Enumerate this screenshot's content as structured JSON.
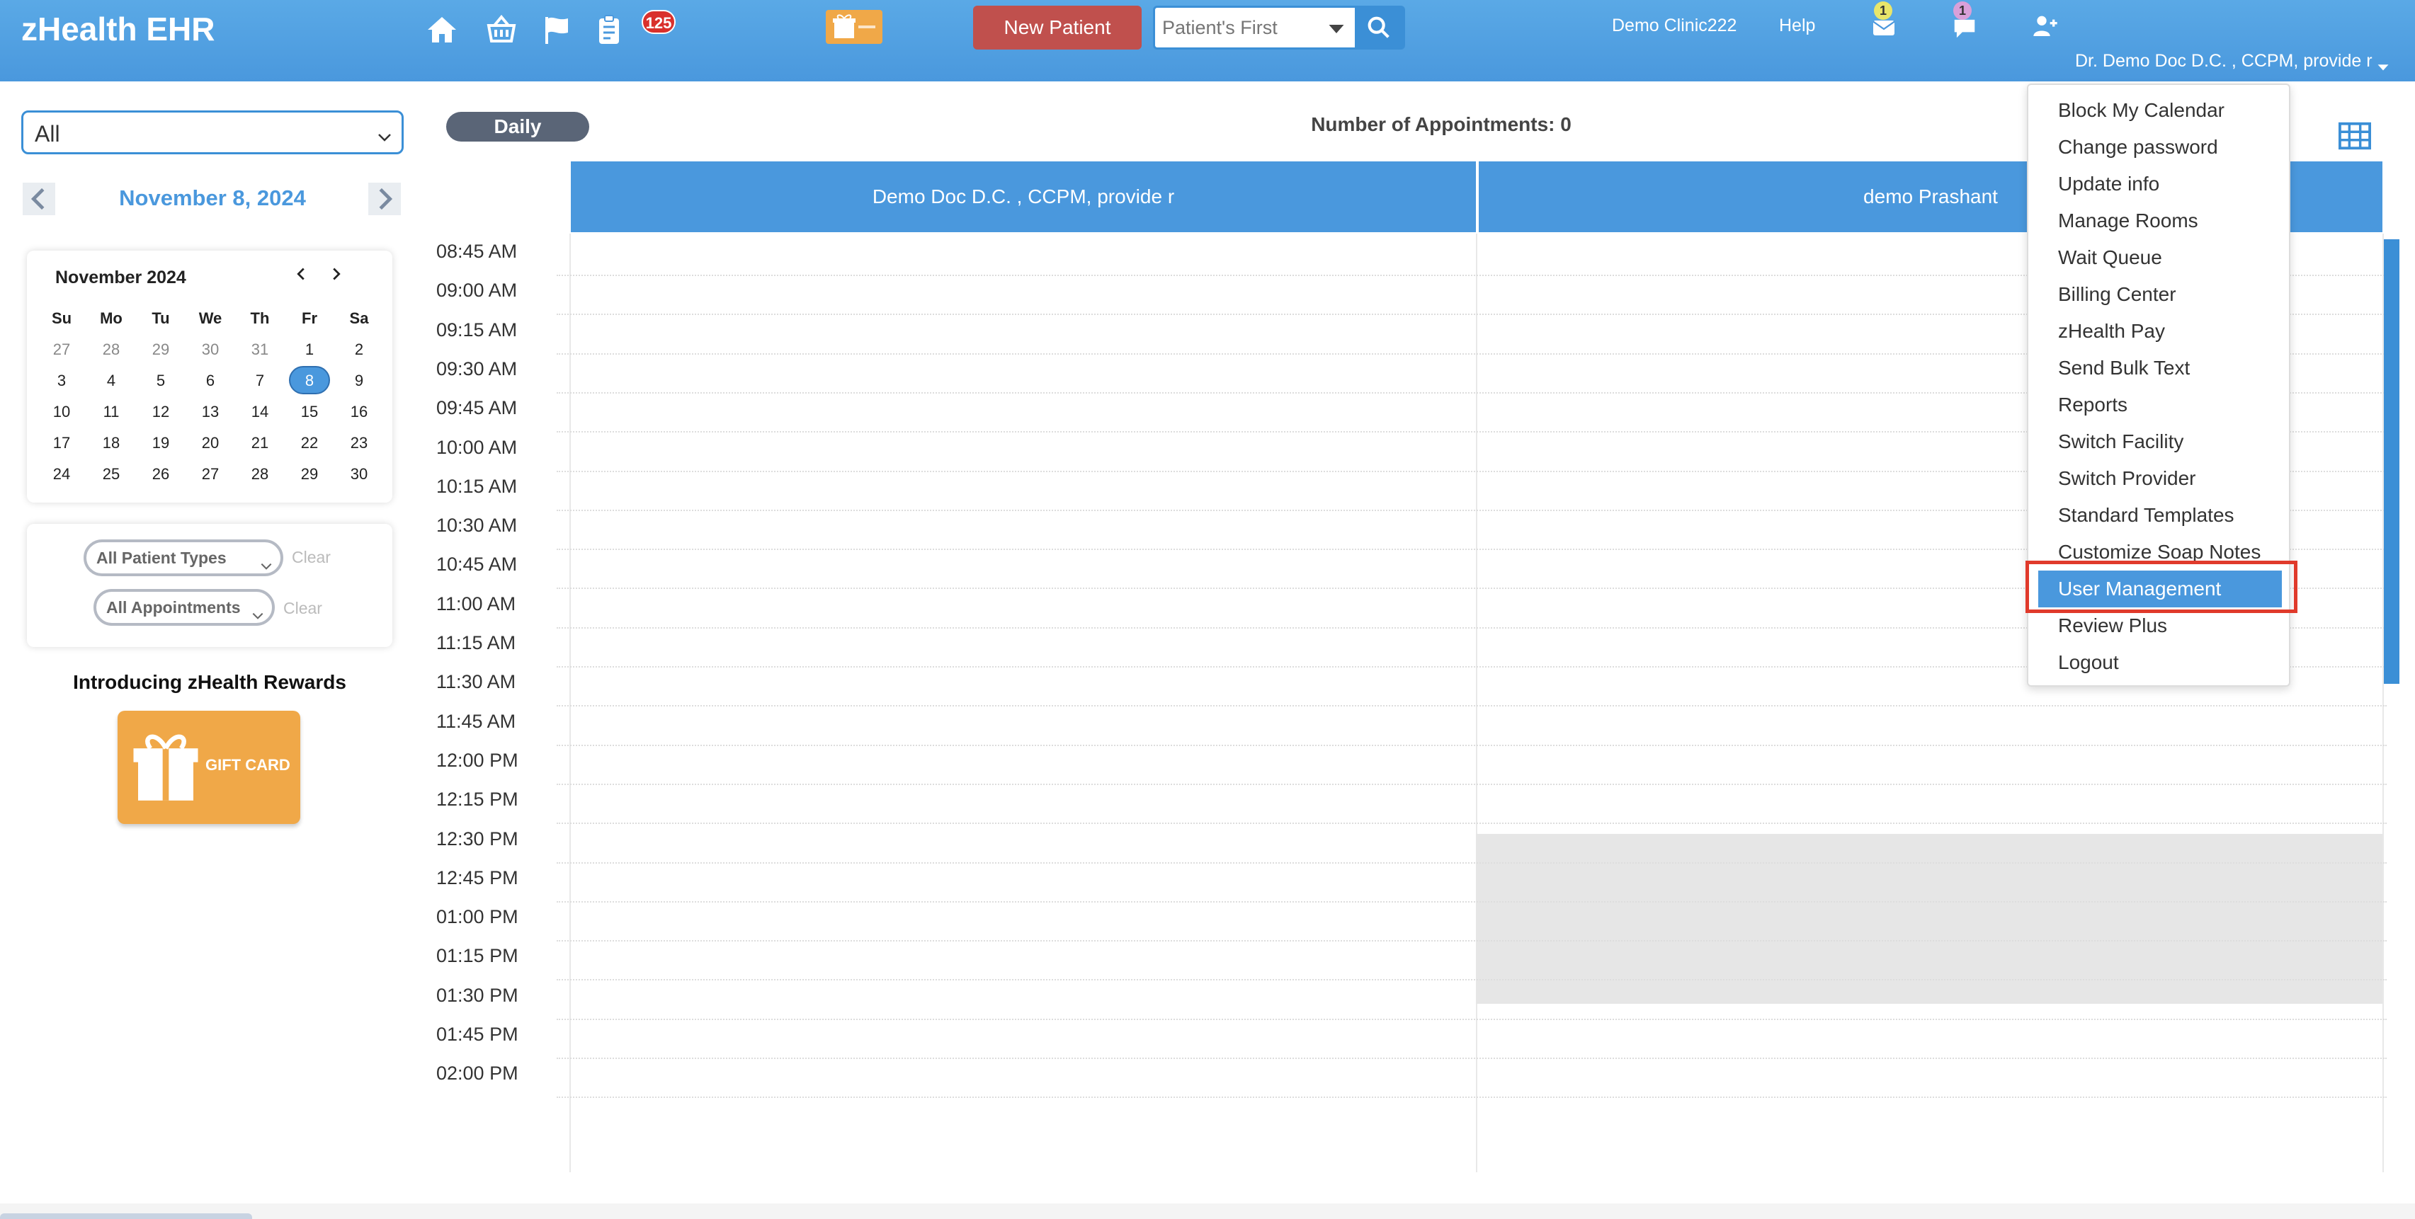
{
  "app": {
    "title": "zHealth EHR"
  },
  "header": {
    "notification_count": "125",
    "new_patient_label": "New Patient",
    "search_placeholder": "Patient's First",
    "clinic_name": "Demo Clinic222",
    "help_label": "Help",
    "mail_badge": "1",
    "chat_badge": "1",
    "user_name": "Dr. Demo Doc D.C. , CCPM, provide r"
  },
  "sidebar": {
    "provider_filter": "All",
    "current_date": "November 8, 2024",
    "calendar": {
      "month_label": "November 2024",
      "weekdays": [
        "Su",
        "Mo",
        "Tu",
        "We",
        "Th",
        "Fr",
        "Sa"
      ],
      "weeks": [
        [
          "27",
          "28",
          "29",
          "30",
          "31",
          "1",
          "2"
        ],
        [
          "3",
          "4",
          "5",
          "6",
          "7",
          "8",
          "9"
        ],
        [
          "10",
          "11",
          "12",
          "13",
          "14",
          "15",
          "16"
        ],
        [
          "17",
          "18",
          "19",
          "20",
          "21",
          "22",
          "23"
        ],
        [
          "24",
          "25",
          "26",
          "27",
          "28",
          "29",
          "30"
        ]
      ],
      "selected_day": "8"
    },
    "filters": {
      "patient_types": "All Patient Types",
      "appointments": "All Appointments",
      "clear_label": "Clear"
    },
    "rewards_title": "Introducing zHealth Rewards",
    "gift_card_label": "GIFT CARD"
  },
  "main": {
    "view_label": "Daily",
    "appointment_count": "Number of Appointments: 0",
    "columns": [
      "Demo Doc D.C. , CCPM, provide r",
      "demo Prashant"
    ],
    "time_slots": [
      "08:45 AM",
      "09:00 AM",
      "09:15 AM",
      "09:30 AM",
      "09:45 AM",
      "10:00 AM",
      "10:15 AM",
      "10:30 AM",
      "10:45 AM",
      "11:00 AM",
      "11:15 AM",
      "11:30 AM",
      "11:45 AM",
      "12:00 PM",
      "12:15 PM",
      "12:30 PM",
      "12:45 PM",
      "01:00 PM",
      "01:15 PM",
      "01:30 PM",
      "01:45 PM",
      "02:00 PM"
    ]
  },
  "user_menu": {
    "items": [
      "Block My Calendar",
      "Change password",
      "Update info",
      "Manage Rooms",
      "Wait Queue",
      "Billing Center",
      "zHealth Pay",
      "Send Bulk Text",
      "Reports",
      "Switch Facility",
      "Switch Provider",
      "Standard Templates",
      "Customize Soap Notes",
      "User Management",
      "Review Plus",
      "Logout"
    ],
    "active_item": "User Management"
  },
  "colors": {
    "header_blue": "#4a98dd",
    "new_patient_red": "#c0504d",
    "highlight_red": "#e03a2b",
    "gift_orange": "#f0a848"
  }
}
